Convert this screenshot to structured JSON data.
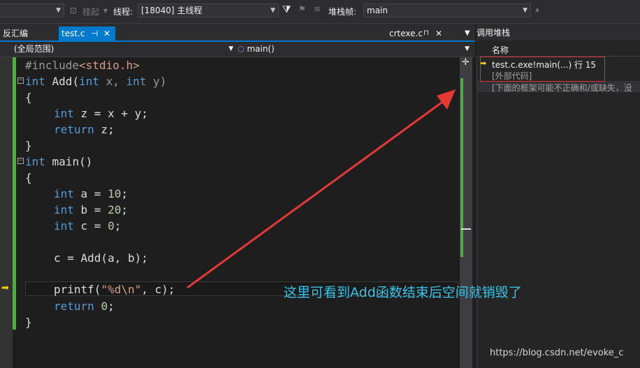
{
  "toolbar": {
    "suspend_label": "挂起",
    "thread_label": "线程:",
    "thread_value": "[18040] 主线程",
    "stackframe_label": "堆栈帧:",
    "stackframe_value": "main"
  },
  "tabs": {
    "disasm": "反汇编",
    "active": "test.c",
    "active_pin": "⊣",
    "active_close": "✕",
    "crtexe": "crtexe.c",
    "crtexe_lock": "🔒"
  },
  "scope": {
    "global": "(全局范围)",
    "function": "main()"
  },
  "code": {
    "l1_a": "#include",
    "l1_b": "<stdio.h>",
    "l2_kw": "int",
    "l2_rest": " Add(",
    "l2_kw2": "int",
    "l2_x": " x, ",
    "l2_kw3": "int",
    "l2_y": " y)",
    "l3": "{",
    "l4_kw": "int",
    "l4_rest": " z = x + y;",
    "l5_kw": "return",
    "l5_rest": " z;",
    "l6": "}",
    "l7_kw": "int",
    "l7_rest": " main()",
    "l8": "{",
    "l9_kw": "int",
    "l9_rest": " a = ",
    "l9_num": "10",
    "l9_end": ";",
    "l10_kw": "int",
    "l10_rest": " b = ",
    "l10_num": "20",
    "l10_end": ";",
    "l11_kw": "int",
    "l11_rest": " c = ",
    "l11_num": "0",
    "l11_end": ";",
    "l13": "c = Add(a, b);",
    "l15_a": "printf(",
    "l15_str": "\"%d\\n\"",
    "l15_b": ", c);",
    "l16_kw": "return",
    "l16_rest": " ",
    "l16_num": "0",
    "l16_end": ";",
    "l17": "}"
  },
  "callstack": {
    "title": "调用堆栈",
    "column_name": "名称",
    "rows": [
      "test.c.exe!main(...) 行 15",
      "[外部代码]",
      "[下面的框架可能不正确和/或缺失，没"
    ]
  },
  "annotation": "这里可看到Add函数结束后空间就销毁了",
  "watermark": "https://blog.csdn.net/evoke_c",
  "colors": {
    "accent": "#007acc",
    "green_bar": "#57a64a",
    "annotation": "#38c4e8",
    "arrow": "#e53935"
  }
}
